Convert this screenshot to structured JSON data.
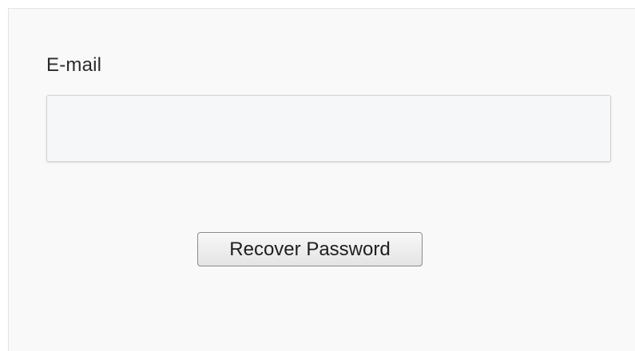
{
  "form": {
    "email_label": "E-mail",
    "email_value": "",
    "recover_button_label": "Recover Password"
  }
}
